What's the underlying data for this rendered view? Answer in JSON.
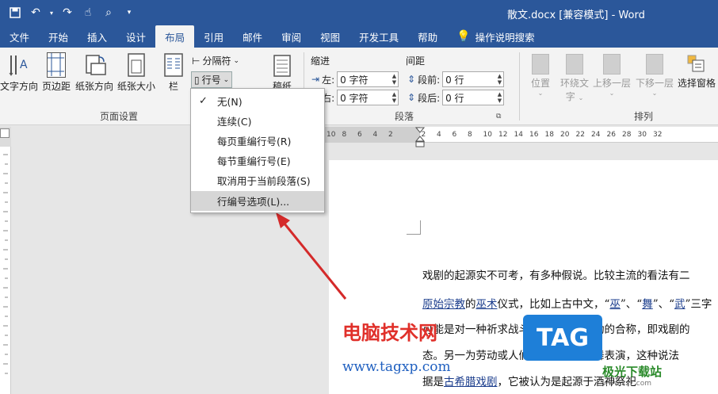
{
  "titlebar": {
    "doc_title": "散文.docx [兼容模式]  -  Word"
  },
  "tabs": [
    "文件",
    "开始",
    "插入",
    "设计",
    "布局",
    "引用",
    "邮件",
    "审阅",
    "视图",
    "开发工具",
    "帮助"
  ],
  "active_tab": "布局",
  "tell_me": "操作说明搜索",
  "ribbon": {
    "page_setup": {
      "text_direction": "文字方向",
      "margins": "页边距",
      "orientation": "纸张方向",
      "size": "纸张大小",
      "columns": "栏",
      "breaks": "分隔符",
      "line_numbers": "行号",
      "hyphen_partial": "稿纸",
      "group_label": "页面设置"
    },
    "paragraph": {
      "indent_label": "缩进",
      "spacing_label": "间距",
      "left_label": "左:",
      "right_label": "右:",
      "left_value": "0 字符",
      "right_value": "0 字符",
      "before_label": "段前:",
      "after_label": "段后:",
      "before_value": "0 行",
      "after_value": "0 行",
      "group_label": "段落"
    },
    "arrange": {
      "position": "位置",
      "wrap_text_1": "环绕文",
      "wrap_text_2": "字",
      "bring_forward": "上移一层",
      "send_backward": "下移一层",
      "selection_pane": "选择窗格",
      "group_label": "排列"
    }
  },
  "menu": {
    "items": [
      {
        "label": "无(N)",
        "checked": true
      },
      {
        "label": "连续(C)",
        "checked": false
      },
      {
        "label": "每页重编行号(R)",
        "checked": false
      },
      {
        "label": "每节重编行号(E)",
        "checked": false
      },
      {
        "label": "取消用于当前段落(S)",
        "checked": false
      },
      {
        "label": "行编号选项(L)...",
        "checked": false
      }
    ]
  },
  "ruler": {
    "ticks": [
      "10",
      "8",
      "6",
      "4",
      "2",
      "2",
      "4",
      "6",
      "8",
      "10",
      "12",
      "14",
      "16",
      "18",
      "20",
      "22",
      "24",
      "26",
      "28",
      "30",
      "32"
    ]
  },
  "document": {
    "line1": "戏剧的起源实不可考，有多种假说。比较主流的看法有二",
    "line2_a": "原始宗教",
    "line2_b": "的",
    "line2_c": "巫术",
    "line2_d": "仪式，比如上古中文，“",
    "line2_e": "巫",
    "line2_f": "”、“",
    "line2_g": "舞",
    "line2_h": "”、“",
    "line2_i": "武",
    "line2_j": "”三字",
    "line3": "可能是对一种祈求战斗胜利的巫术活动的合称，即戏剧的",
    "line4": "态。另一为劳动或人们下班的即兴歌舞表演，这种说法",
    "line5_a": "据是",
    "line5_b": "古希腊戏剧",
    "line5_c": "，它被认为是起源于酒神祭祀"
  },
  "watermark": {
    "site_name": "电脑技术网",
    "site_url": "www.tagxp.com",
    "tag": "TAG",
    "logo2": "极光下载站",
    "logo2_sub": "www.xz7.com"
  },
  "colors": {
    "title_bar": "#2b579a",
    "ribbon_bg": "#f3f3f3",
    "arrow": "#d42a2a"
  }
}
